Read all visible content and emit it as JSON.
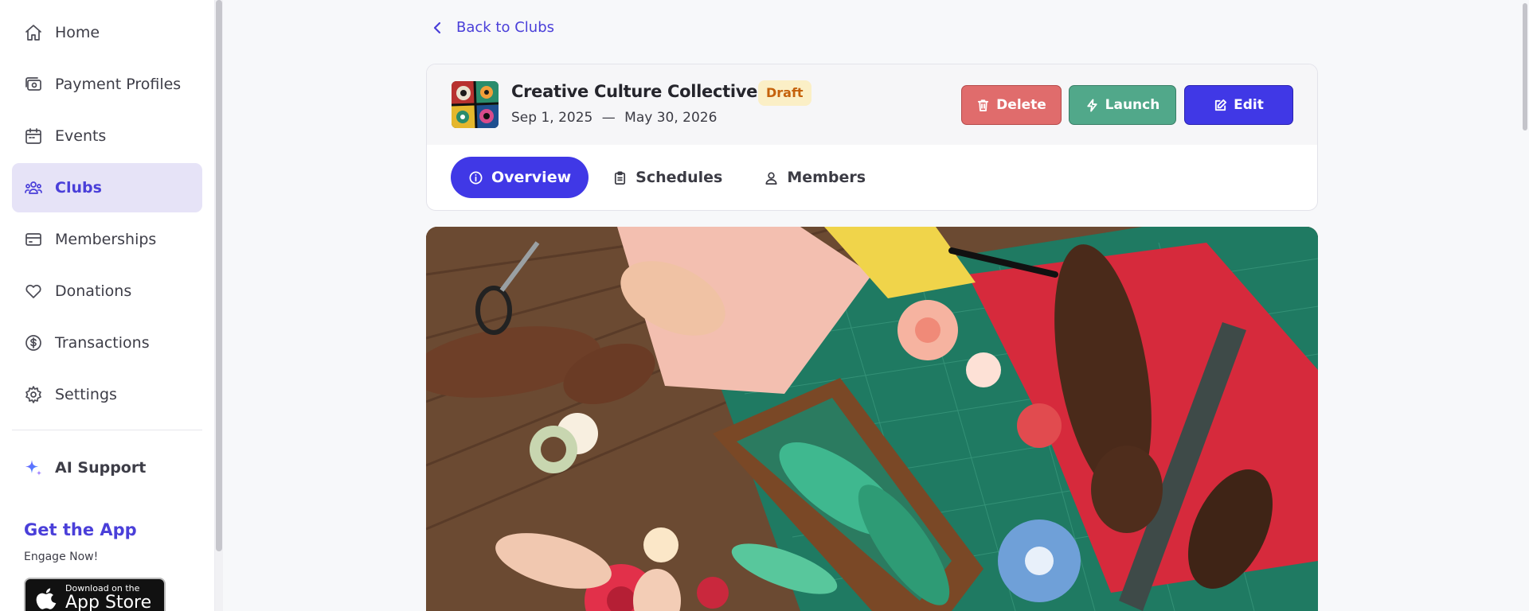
{
  "sidebar": {
    "items": [
      {
        "label": "Home",
        "icon": "home-icon",
        "active": false
      },
      {
        "label": "Payment Profiles",
        "icon": "payment-profiles-icon",
        "active": false
      },
      {
        "label": "Events",
        "icon": "calendar-icon",
        "active": false
      },
      {
        "label": "Clubs",
        "icon": "users-group-icon",
        "active": true
      },
      {
        "label": "Memberships",
        "icon": "membership-card-icon",
        "active": false
      },
      {
        "label": "Donations",
        "icon": "heart-icon",
        "active": false
      },
      {
        "label": "Transactions",
        "icon": "dollar-circle-icon",
        "active": false
      },
      {
        "label": "Settings",
        "icon": "gear-icon",
        "active": false
      }
    ],
    "ai_support": "AI Support",
    "get_app": {
      "title": "Get the App",
      "subtitle": "Engage Now!",
      "appstore_small": "Download on the",
      "appstore_big": "App Store"
    }
  },
  "main": {
    "back_link": "Back to Clubs",
    "club": {
      "name": "Creative Culture Collective",
      "status": "Draft",
      "start_date": "Sep 1, 2025",
      "date_separator": "—",
      "end_date": "May 30, 2026"
    },
    "actions": {
      "delete": "Delete",
      "launch": "Launch",
      "edit": "Edit"
    },
    "tabs": [
      {
        "label": "Overview",
        "icon": "info-icon",
        "active": true
      },
      {
        "label": "Schedules",
        "icon": "clipboard-icon",
        "active": false
      },
      {
        "label": "Members",
        "icon": "user-icon",
        "active": false
      }
    ]
  },
  "colors": {
    "accent": "#4038e6",
    "active_nav_bg": "#e6e3f7",
    "delete": "#e06c6c",
    "launch": "#51a88a",
    "draft_bg": "#fbefc6",
    "draft_text": "#c5620c"
  }
}
